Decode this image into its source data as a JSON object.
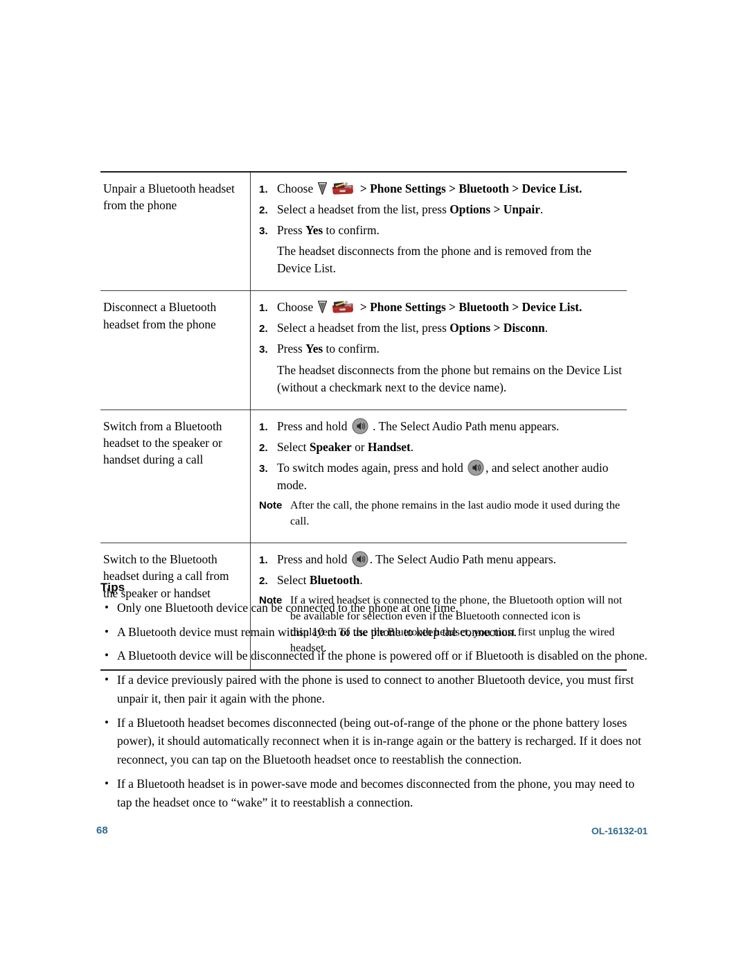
{
  "document": {
    "footer_page_number": "68",
    "footer_doc_id": "OL-16132-01",
    "footer_color": "#2e6a8e"
  },
  "icons": {
    "triangle": "triangle-glyph-icon",
    "toolbox": "settings-toolbox-icon",
    "speaker": "speaker-button-icon"
  },
  "table": {
    "rows": [
      {
        "task": "Unpair a Bluetooth headset from the phone",
        "steps": [
          {
            "num": "1.",
            "parts": [
              {
                "t": "text",
                "v": "Choose "
              },
              {
                "t": "icon",
                "v": "triangle"
              },
              {
                "t": "icon",
                "v": "toolbox"
              },
              {
                "t": "bold",
                "v": " > Phone Settings > Bluetooth > Device List."
              }
            ]
          },
          {
            "num": "2.",
            "parts": [
              {
                "t": "text",
                "v": "Select a headset from the list, press "
              },
              {
                "t": "bold",
                "v": "Options > Unpair"
              },
              {
                "t": "text",
                "v": "."
              }
            ]
          },
          {
            "num": "3.",
            "parts": [
              {
                "t": "text",
                "v": "Press "
              },
              {
                "t": "bold",
                "v": "Yes"
              },
              {
                "t": "text",
                "v": " to confirm."
              }
            ]
          }
        ],
        "continuation": "The headset disconnects from the phone and is removed from the Device List."
      },
      {
        "task": "Disconnect a Bluetooth headset from the phone",
        "steps": [
          {
            "num": "1.",
            "parts": [
              {
                "t": "text",
                "v": "Choose "
              },
              {
                "t": "icon",
                "v": "triangle"
              },
              {
                "t": "icon",
                "v": "toolbox"
              },
              {
                "t": "bold",
                "v": " > Phone Settings > Bluetooth > Device List."
              }
            ]
          },
          {
            "num": "2.",
            "parts": [
              {
                "t": "text",
                "v": "Select a headset from the list, press "
              },
              {
                "t": "bold",
                "v": "Options > Disconn"
              },
              {
                "t": "text",
                "v": "."
              }
            ]
          },
          {
            "num": "3.",
            "parts": [
              {
                "t": "text",
                "v": "Press "
              },
              {
                "t": "bold",
                "v": "Yes"
              },
              {
                "t": "text",
                "v": " to confirm."
              }
            ]
          }
        ],
        "continuation": "The headset disconnects from the phone but remains on the Device List (without a checkmark next to the device name)."
      },
      {
        "task": "Switch from a Bluetooth headset to the speaker or handset during a call",
        "steps": [
          {
            "num": "1.",
            "parts": [
              {
                "t": "text",
                "v": "Press and hold "
              },
              {
                "t": "icon",
                "v": "speaker"
              },
              {
                "t": "text",
                "v": " . The Select Audio Path menu appears."
              }
            ]
          },
          {
            "num": "2.",
            "parts": [
              {
                "t": "text",
                "v": "Select "
              },
              {
                "t": "bold",
                "v": "Speaker"
              },
              {
                "t": "text",
                "v": " or "
              },
              {
                "t": "bold",
                "v": "Handset"
              },
              {
                "t": "text",
                "v": "."
              }
            ]
          },
          {
            "num": "3.",
            "parts": [
              {
                "t": "text",
                "v": "To switch modes again, press and hold "
              },
              {
                "t": "icon",
                "v": "speaker"
              },
              {
                "t": "text",
                "v": ", and select another audio mode."
              }
            ]
          },
          {
            "num": "Note",
            "note": true,
            "parts": [
              {
                "t": "text",
                "v": "After the call, the phone remains in the last audio mode it used during the call."
              }
            ]
          }
        ],
        "continuation": ""
      },
      {
        "task": "Switch to the Bluetooth headset during a call from the speaker or handset",
        "steps": [
          {
            "num": "1.",
            "parts": [
              {
                "t": "text",
                "v": "Press and hold "
              },
              {
                "t": "icon",
                "v": "speaker"
              },
              {
                "t": "text",
                "v": ". The Select Audio Path menu appears."
              }
            ]
          },
          {
            "num": "2.",
            "parts": [
              {
                "t": "text",
                "v": "Select "
              },
              {
                "t": "bold",
                "v": "Bluetooth"
              },
              {
                "t": "text",
                "v": "."
              }
            ]
          },
          {
            "num": "Note",
            "note": true,
            "parts": [
              {
                "t": "text",
                "v": "If a wired headset is connected to the phone, the Bluetooth option will not be available for selection even if the Bluetooth connected icon is displayed. To use the Bluetooth headset, you must first unplug the wired headset."
              }
            ]
          }
        ],
        "continuation": ""
      }
    ]
  },
  "tips": {
    "heading": "Tips",
    "bullet_glyph": "•",
    "items": [
      "Only one Bluetooth device can be connected to the phone at one time.",
      "A Bluetooth device must remain within 10 m of the phone to keep the connection.",
      "A Bluetooth device will be disconnected if the phone is powered off or if Bluetooth is disabled on the phone.",
      "If a device previously paired with the phone is used to connect to another Bluetooth device, you must first unpair it, then pair it again with the phone.",
      "If a Bluetooth headset becomes disconnected (being out-of-range of the phone or the phone battery loses power), it should automatically reconnect when it is in-range again or the battery is recharged. If it does not reconnect, you can tap on the Bluetooth headset once to reestablish the connection.",
      "If a Bluetooth headset is in power-save mode and becomes disconnected from the phone, you may need to tap the headset once to “wake” it to reestablish a connection."
    ]
  }
}
